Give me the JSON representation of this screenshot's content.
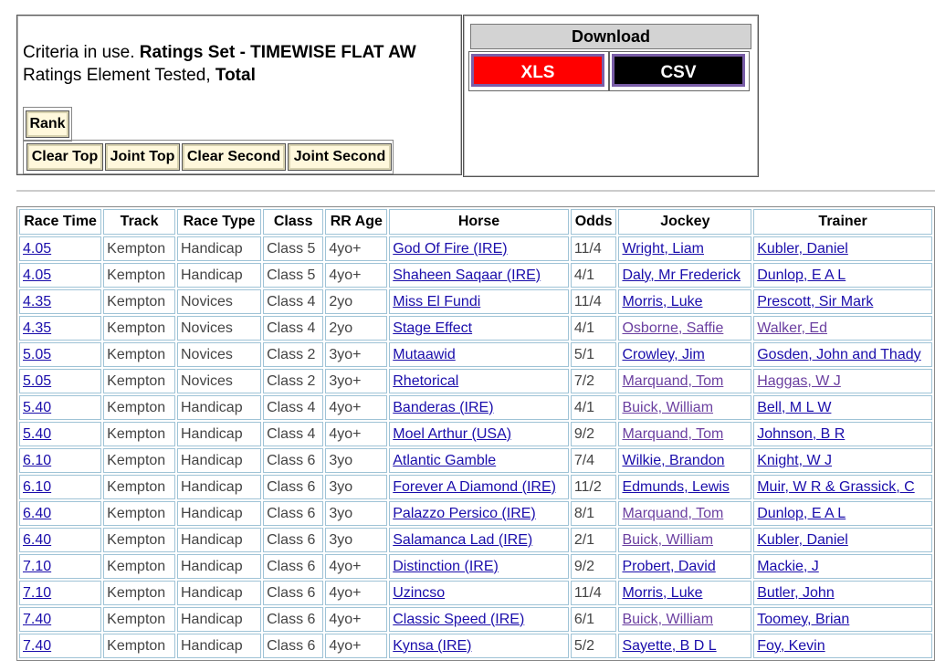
{
  "criteria": {
    "prefix": "Criteria in use. ",
    "ratings_set": "Ratings Set - TIMEWISE FLAT AW",
    "element_prefix": "Ratings Element Tested, ",
    "element": "Total"
  },
  "buttons": {
    "rank": "Rank",
    "clear_top": "Clear Top",
    "joint_top": "Joint Top",
    "clear_second": "Clear Second",
    "joint_second": "Joint Second"
  },
  "download": {
    "title": "Download",
    "xls": "XLS",
    "csv": "CSV"
  },
  "colors": {
    "xls_bg": "#ff0000",
    "csv_bg": "#000000",
    "link": "#1a0dab",
    "visited_link": "#6b3fa0"
  },
  "table": {
    "headers": [
      "Race Time",
      "Track",
      "Race Type",
      "Class",
      "RR Age",
      "Horse",
      "Odds",
      "Jockey",
      "Trainer"
    ],
    "rows": [
      {
        "time": "4.05",
        "track": "Kempton",
        "type": "Handicap",
        "class": "Class 5",
        "age": "4yo+",
        "horse": "God Of Fire (IRE)",
        "odds": "11/4",
        "jockey": "Wright, Liam",
        "jv": false,
        "trainer": "Kubler, Daniel",
        "tv": false
      },
      {
        "time": "4.05",
        "track": "Kempton",
        "type": "Handicap",
        "class": "Class 5",
        "age": "4yo+",
        "horse": "Shaheen Saqaar (IRE)",
        "odds": "4/1",
        "jockey": "Daly, Mr Frederick",
        "jv": false,
        "trainer": "Dunlop, E A L",
        "tv": false
      },
      {
        "time": "4.35",
        "track": "Kempton",
        "type": "Novices",
        "class": "Class 4",
        "age": "2yo",
        "horse": "Miss El Fundi",
        "odds": "11/4",
        "jockey": "Morris, Luke",
        "jv": false,
        "trainer": "Prescott, Sir Mark",
        "tv": false
      },
      {
        "time": "4.35",
        "track": "Kempton",
        "type": "Novices",
        "class": "Class 4",
        "age": "2yo",
        "horse": "Stage Effect",
        "odds": "4/1",
        "jockey": "Osborne, Saffie",
        "jv": true,
        "trainer": "Walker, Ed",
        "tv": true
      },
      {
        "time": "5.05",
        "track": "Kempton",
        "type": "Novices",
        "class": "Class 2",
        "age": "3yo+",
        "horse": "Mutaawid",
        "odds": "5/1",
        "jockey": "Crowley, Jim",
        "jv": false,
        "trainer": "Gosden, John and Thady",
        "tv": false
      },
      {
        "time": "5.05",
        "track": "Kempton",
        "type": "Novices",
        "class": "Class 2",
        "age": "3yo+",
        "horse": "Rhetorical",
        "odds": "7/2",
        "jockey": "Marquand, Tom",
        "jv": true,
        "trainer": "Haggas, W J",
        "tv": true
      },
      {
        "time": "5.40",
        "track": "Kempton",
        "type": "Handicap",
        "class": "Class 4",
        "age": "4yo+",
        "horse": "Banderas (IRE)",
        "odds": "4/1",
        "jockey": "Buick, William",
        "jv": true,
        "trainer": "Bell, M L W",
        "tv": false
      },
      {
        "time": "5.40",
        "track": "Kempton",
        "type": "Handicap",
        "class": "Class 4",
        "age": "4yo+",
        "horse": "Moel Arthur (USA)",
        "odds": "9/2",
        "jockey": "Marquand, Tom",
        "jv": true,
        "trainer": "Johnson, B R",
        "tv": false
      },
      {
        "time": "6.10",
        "track": "Kempton",
        "type": "Handicap",
        "class": "Class 6",
        "age": "3yo",
        "horse": "Atlantic Gamble",
        "odds": "7/4",
        "jockey": "Wilkie, Brandon",
        "jv": false,
        "trainer": "Knight, W J",
        "tv": false
      },
      {
        "time": "6.10",
        "track": "Kempton",
        "type": "Handicap",
        "class": "Class 6",
        "age": "3yo",
        "horse": "Forever A Diamond (IRE)",
        "odds": "11/2",
        "jockey": "Edmunds, Lewis",
        "jv": false,
        "trainer": "Muir, W R & Grassick, C",
        "tv": false
      },
      {
        "time": "6.40",
        "track": "Kempton",
        "type": "Handicap",
        "class": "Class 6",
        "age": "3yo",
        "horse": "Palazzo Persico (IRE)",
        "odds": "8/1",
        "jockey": "Marquand, Tom",
        "jv": true,
        "trainer": "Dunlop, E A L",
        "tv": false
      },
      {
        "time": "6.40",
        "track": "Kempton",
        "type": "Handicap",
        "class": "Class 6",
        "age": "3yo",
        "horse": "Salamanca Lad (IRE)",
        "odds": "2/1",
        "jockey": "Buick, William",
        "jv": true,
        "trainer": "Kubler, Daniel",
        "tv": false
      },
      {
        "time": "7.10",
        "track": "Kempton",
        "type": "Handicap",
        "class": "Class 6",
        "age": "4yo+",
        "horse": "Distinction (IRE)",
        "odds": "9/2",
        "jockey": "Probert, David",
        "jv": false,
        "trainer": "Mackie, J",
        "tv": false
      },
      {
        "time": "7.10",
        "track": "Kempton",
        "type": "Handicap",
        "class": "Class 6",
        "age": "4yo+",
        "horse": "Uzincso",
        "odds": "11/4",
        "jockey": "Morris, Luke",
        "jv": false,
        "trainer": "Butler, John",
        "tv": false
      },
      {
        "time": "7.40",
        "track": "Kempton",
        "type": "Handicap",
        "class": "Class 6",
        "age": "4yo+",
        "horse": "Classic Speed (IRE)",
        "odds": "6/1",
        "jockey": "Buick, William",
        "jv": true,
        "trainer": "Toomey, Brian",
        "tv": false
      },
      {
        "time": "7.40",
        "track": "Kempton",
        "type": "Handicap",
        "class": "Class 6",
        "age": "4yo+",
        "horse": "Kynsa (IRE)",
        "odds": "5/2",
        "jockey": "Sayette, B D L",
        "jv": false,
        "trainer": "Foy, Kevin",
        "tv": false
      }
    ]
  }
}
